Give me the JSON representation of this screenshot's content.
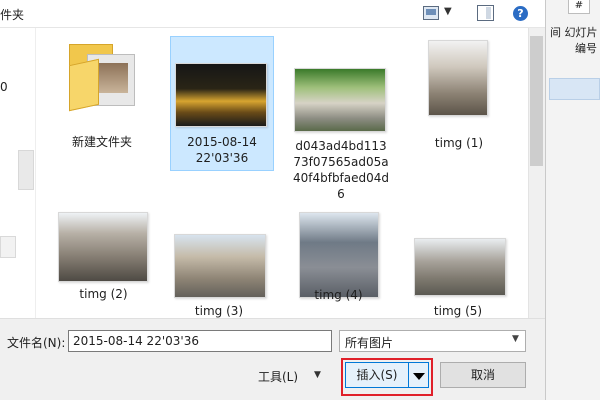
{
  "header": {
    "title_fragment": "件夹",
    "view_dropdown_glyph": "▼",
    "help_glyph": "?"
  },
  "left_nav": {
    "fragment": "0"
  },
  "files": [
    {
      "name": "新建文件夹",
      "kind": "folder"
    },
    {
      "name": "2015-08-14 22'03'36",
      "kind": "image",
      "selected": true
    },
    {
      "name": "d043ad4bd11373f07565ad05a40f4bfbfaed04d6",
      "kind": "image"
    },
    {
      "name": "timg (1)",
      "kind": "image"
    },
    {
      "name": "timg (2)",
      "kind": "image"
    },
    {
      "name": "timg (3)",
      "kind": "image"
    },
    {
      "name": "timg (4)",
      "kind": "image"
    },
    {
      "name": "timg (5)",
      "kind": "image"
    }
  ],
  "labels": {
    "folder": "新建文件夹",
    "selected_l1": "2015-08-14",
    "selected_l2": "22'03'36",
    "hash_l1": "d043ad4bd113",
    "hash_l2": "73f07565ad05a",
    "hash_l3": "40f4bfbfaed04d",
    "hash_l4": "6",
    "timg1": "timg (1)",
    "timg2": "timg (2)",
    "timg3": "timg (3)",
    "timg4": "timg (4)",
    "timg5": "timg (5)"
  },
  "bottom": {
    "filename_label": "文件名(N):",
    "filename_value": "2015-08-14 22'03'36",
    "filetype_value": "所有图片",
    "tools_label": "工具(L)",
    "insert_label": "插入(S)",
    "cancel_label": "取消",
    "dropdown_glyph": "▼"
  },
  "right_panel": {
    "tab": "#",
    "line1": "间 幻灯片",
    "line2": "编号"
  },
  "colors": {
    "selection": "#cce8ff",
    "primary_border": "#0078d7",
    "highlight": "#e0202a",
    "folder": "#f1c74c"
  },
  "icons": [
    "view-icon",
    "pane-icon",
    "help-icon",
    "folder-icon",
    "chevron-down-icon"
  ]
}
